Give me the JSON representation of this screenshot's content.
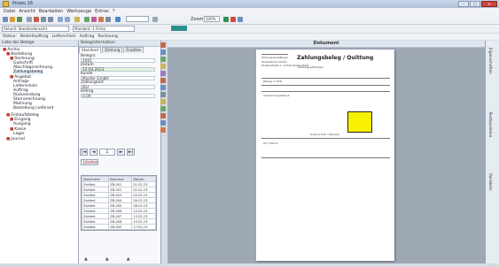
{
  "window": {
    "title": "Prowo 16"
  },
  "menu": [
    "Datei",
    "Ansicht",
    "Bearbeiten",
    "Werkzeuge",
    "Extras",
    "?"
  ],
  "toolbar": {
    "zoom_label": "Zoom:",
    "zoom_value": "100%",
    "small_input": "",
    "combo1": "Aktuell: Standardansicht",
    "combo2": "Mandant: 1 Firma",
    "teal_color": "#2e8f8c"
  },
  "status_row": [
    "Status:",
    "Bestellauftrag",
    "Lieferschein",
    "Auftrag",
    "Rechnung"
  ],
  "left_panel": {
    "title": "Liste der Belege",
    "tree": [
      "Archiv",
      "Bestellung",
      "Rechnung",
      "Gutschrift",
      "Abschlagsrechnung",
      "Zahlungsbeleg",
      "Angebot",
      "Anfrage",
      "Lieferschein",
      "Auftrag",
      "Rücksendung",
      "Stornorechnung",
      "Mahnung",
      "Bestellung Lieferant",
      "Einkaufsbeleg",
      "Eingang",
      "Ausgang",
      "Kasse",
      "Lager",
      "Journal"
    ]
  },
  "mid_panel": {
    "title": "Beleginformation",
    "tabs": [
      "Standard",
      "Zahlung",
      "Zusätze"
    ],
    "fields": [
      {
        "label": "Belegnr.",
        "value": "1001"
      },
      {
        "label": "Datum",
        "value": "12.03.2023"
      },
      {
        "label": "Kunde",
        "value": "Muster GmbH"
      },
      {
        "label": "Zahlungsart",
        "value": "Bar"
      },
      {
        "label": "Betrag",
        "value": "0,00"
      }
    ],
    "nav": {
      "first": "|◄",
      "prev": "◄",
      "page": "1",
      "next": "►",
      "last": "►|"
    },
    "delete_label": "Löschen",
    "grid": {
      "headers": [
        "Dokument",
        "Nummer",
        "Datum"
      ],
      "rows": [
        [
          "Zahlbel.",
          "ZB-001",
          "01.02.23"
        ],
        [
          "Zahlbel.",
          "ZB-002",
          "02.02.23"
        ],
        [
          "Zahlbel.",
          "ZB-003",
          "05.02.23"
        ],
        [
          "Zahlbel.",
          "ZB-004",
          "06.02.23"
        ],
        [
          "Zahlbel.",
          "ZB-005",
          "08.02.23"
        ],
        [
          "Zahlbel.",
          "ZB-006",
          "10.02.23"
        ],
        [
          "Zahlbel.",
          "ZB-007",
          "13.02.23"
        ],
        [
          "Zahlbel.",
          "ZB-008",
          "15.02.23"
        ],
        [
          "Zahlbel.",
          "ZB-009",
          "17.02.23"
        ]
      ]
    }
  },
  "document": {
    "header": "Dokument",
    "page_title": "Zahlungsbeleg / Quittung",
    "body_lines": [
      "Zahlungsempfänger",
      "Musterfirma GmbH",
      "Musterstraße 1, 12345 Musterstadt",
      "Zahlungspflichtiger",
      "Betrag in EUR",
      "Verwendungszweck",
      "Ort, Datum",
      "Unterschrift / Stempel"
    ]
  },
  "right_strip": {
    "tabs": [
      "Eigenschaften",
      "Textbausteine",
      "Variablen"
    ]
  }
}
